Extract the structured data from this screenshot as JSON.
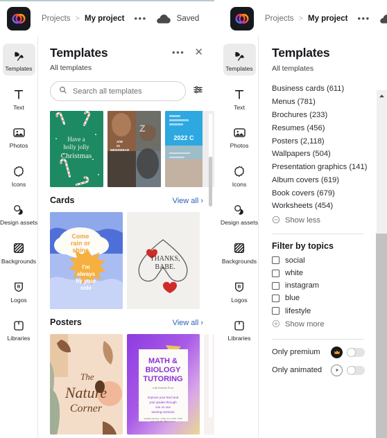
{
  "window": {
    "panels": [
      "left-panel",
      "right-panel"
    ]
  },
  "topbar": {
    "logo_name": "adobe-express-logo",
    "breadcrumb": {
      "root": "Projects",
      "separator": ">",
      "current": "My project"
    },
    "more_label": "•••",
    "cloud_icon": "cloud-icon",
    "status": "Saved"
  },
  "rail": {
    "items": [
      {
        "label": "Templates",
        "icon": "templates-icon",
        "active": true
      },
      {
        "label": "Text",
        "icon": "text-icon",
        "active": false
      },
      {
        "label": "Photos",
        "icon": "photos-icon",
        "active": false
      },
      {
        "label": "Icons",
        "icon": "icons-icon",
        "active": false
      },
      {
        "label": "Design assets",
        "icon": "design-assets-icon",
        "active": false
      },
      {
        "label": "Backgrounds",
        "icon": "backgrounds-icon",
        "active": false
      },
      {
        "label": "Logos",
        "icon": "logos-icon",
        "active": false
      },
      {
        "label": "Libraries",
        "icon": "libraries-icon",
        "active": false
      }
    ]
  },
  "left_panel": {
    "title": "Templates",
    "subtitle": "All templates",
    "more_label": "•••",
    "close_label": "✕",
    "search": {
      "placeholder": "Search all templates",
      "icon": "search-icon",
      "filter_icon": "filter-sliders-icon"
    },
    "featured_row": [
      {
        "name": "christmas-card-template",
        "text": "Have a holly jolly Christmas"
      },
      {
        "name": "menswear-collage-template",
        "text": "A/W 21 MENSWEAR"
      },
      {
        "name": "2022-calendar-template",
        "text": "2022 C"
      }
    ],
    "sections": [
      {
        "title": "Cards",
        "view_all": "View all ›",
        "items": [
          {
            "name": "come-rain-or-shine-card",
            "line1": "Come rain or shine",
            "line2": "I'm always by your side"
          },
          {
            "name": "thanks-babe-card",
            "line1": "THANKS,",
            "line2": "BABE."
          }
        ]
      },
      {
        "title": "Posters",
        "view_all": "View all ›",
        "items": [
          {
            "name": "nature-corner-poster",
            "line1": "The",
            "line2": "Nature",
            "line3": "Corner"
          },
          {
            "name": "math-biology-tutoring-poster",
            "line1": "MATH &",
            "line2": "BIOLOGY",
            "line3": "TUTORING",
            "sub": "with Jennifer Frost",
            "body": "Improve your level and your grades through one on one tutoring sessions",
            "footer": "Available Monday - Friday, from 5 PM - 8 PM  Call +123 456 7890 for book"
          },
          {
            "name": "third-poster-partial",
            "line1": ""
          }
        ]
      }
    ],
    "scrollbar": {
      "name": "left-panel-scrollbar"
    }
  },
  "right_panel": {
    "title": "Templates",
    "subtitle": "All templates",
    "categories": [
      "Business cards (611)",
      "Menus (781)",
      "Brochures (233)",
      "Resumes (456)",
      "Posters (2,118)",
      "Wallpapers (504)",
      "Presentation graphics (141)",
      "Album covers (619)",
      "Book covers (679)",
      "Worksheets (454)"
    ],
    "show_less": "Show less",
    "filter_title": "Filter by topics",
    "topics": [
      {
        "label": "social",
        "checked": false
      },
      {
        "label": "white",
        "checked": false
      },
      {
        "label": "instagram",
        "checked": false
      },
      {
        "label": "blue",
        "checked": false
      },
      {
        "label": "lifestyle",
        "checked": false
      }
    ],
    "show_more": "Show more",
    "toggles": [
      {
        "label": "Only premium",
        "badge": "crown-icon",
        "on": false
      },
      {
        "label": "Only animated",
        "badge": "play-icon",
        "on": false
      }
    ],
    "scrollbar": {
      "name": "right-panel-scrollbar",
      "arrow": "scroll-up-arrow"
    }
  },
  "colors": {
    "accent_link": "#2c5fb5",
    "active_rail": "#ebebeb",
    "text": "#17191e",
    "muted": "#6e6e6e"
  }
}
